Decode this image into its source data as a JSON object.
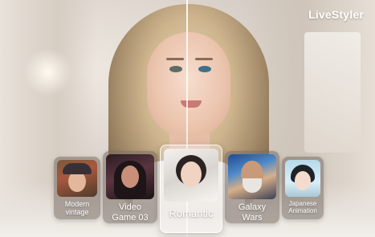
{
  "app": {
    "brand": "LiveStyler"
  },
  "styles": [
    {
      "name": "style-card-modern-vintage",
      "label": "Modern\nvintage",
      "selected": false,
      "thumb": "vintage-portrait"
    },
    {
      "name": "style-card-video-game-03",
      "label": "Video\nGame 03",
      "selected": false,
      "thumb": "game-character-portrait"
    },
    {
      "name": "style-card-romantic",
      "label": "Romantic",
      "selected": true,
      "thumb": "romantic-portrait"
    },
    {
      "name": "style-card-galaxy-wars",
      "label": "Galaxy\nWars",
      "selected": false,
      "thumb": "sci-fi-warrior-portrait"
    },
    {
      "name": "style-card-japanese-animation",
      "label": "Japanese\nAnimation",
      "selected": false,
      "thumb": "anime-portrait"
    }
  ],
  "colors": {
    "brand_text": "#ffffff",
    "selected_border": "#ffffff",
    "card_bg": "#786c64"
  }
}
